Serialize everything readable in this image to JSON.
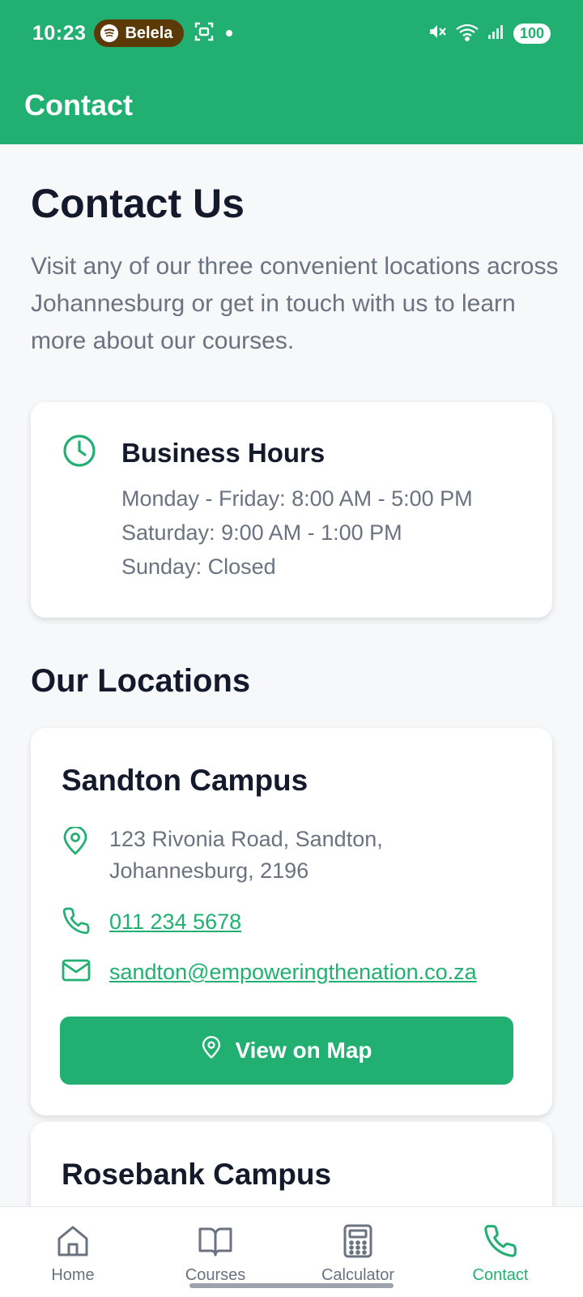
{
  "status_bar": {
    "time": "10:23",
    "media_pill": "Belela",
    "battery": "100"
  },
  "app_bar": {
    "title": "Contact"
  },
  "page": {
    "title": "Contact Us",
    "intro": "Visit any of our three convenient locations across Johannesburg or get in touch with us to learn more about our courses."
  },
  "business_hours": {
    "title": "Business Hours",
    "lines": [
      "Monday - Friday: 8:00 AM - 5:00 PM",
      "Saturday: 9:00 AM - 1:00 PM",
      "Sunday: Closed"
    ]
  },
  "locations_section": {
    "title": "Our Locations"
  },
  "locations": [
    {
      "name": "Sandton Campus",
      "address": "123 Rivonia Road, Sandton, Johannesburg, 2196",
      "phone": "011 234 5678",
      "email": "sandton@empoweringthenation.co.za",
      "map_button": "View on Map"
    },
    {
      "name": "Rosebank Campus"
    }
  ],
  "bottom_nav": {
    "items": [
      {
        "label": "Home",
        "icon": "home-icon"
      },
      {
        "label": "Courses",
        "icon": "book-icon"
      },
      {
        "label": "Calculator",
        "icon": "calculator-icon"
      },
      {
        "label": "Contact",
        "icon": "phone-icon",
        "active": true
      }
    ]
  },
  "colors": {
    "accent": "#21b072",
    "text_dark": "#141a2c",
    "text_muted": "#6b7280",
    "background": "#f7f8fa"
  }
}
